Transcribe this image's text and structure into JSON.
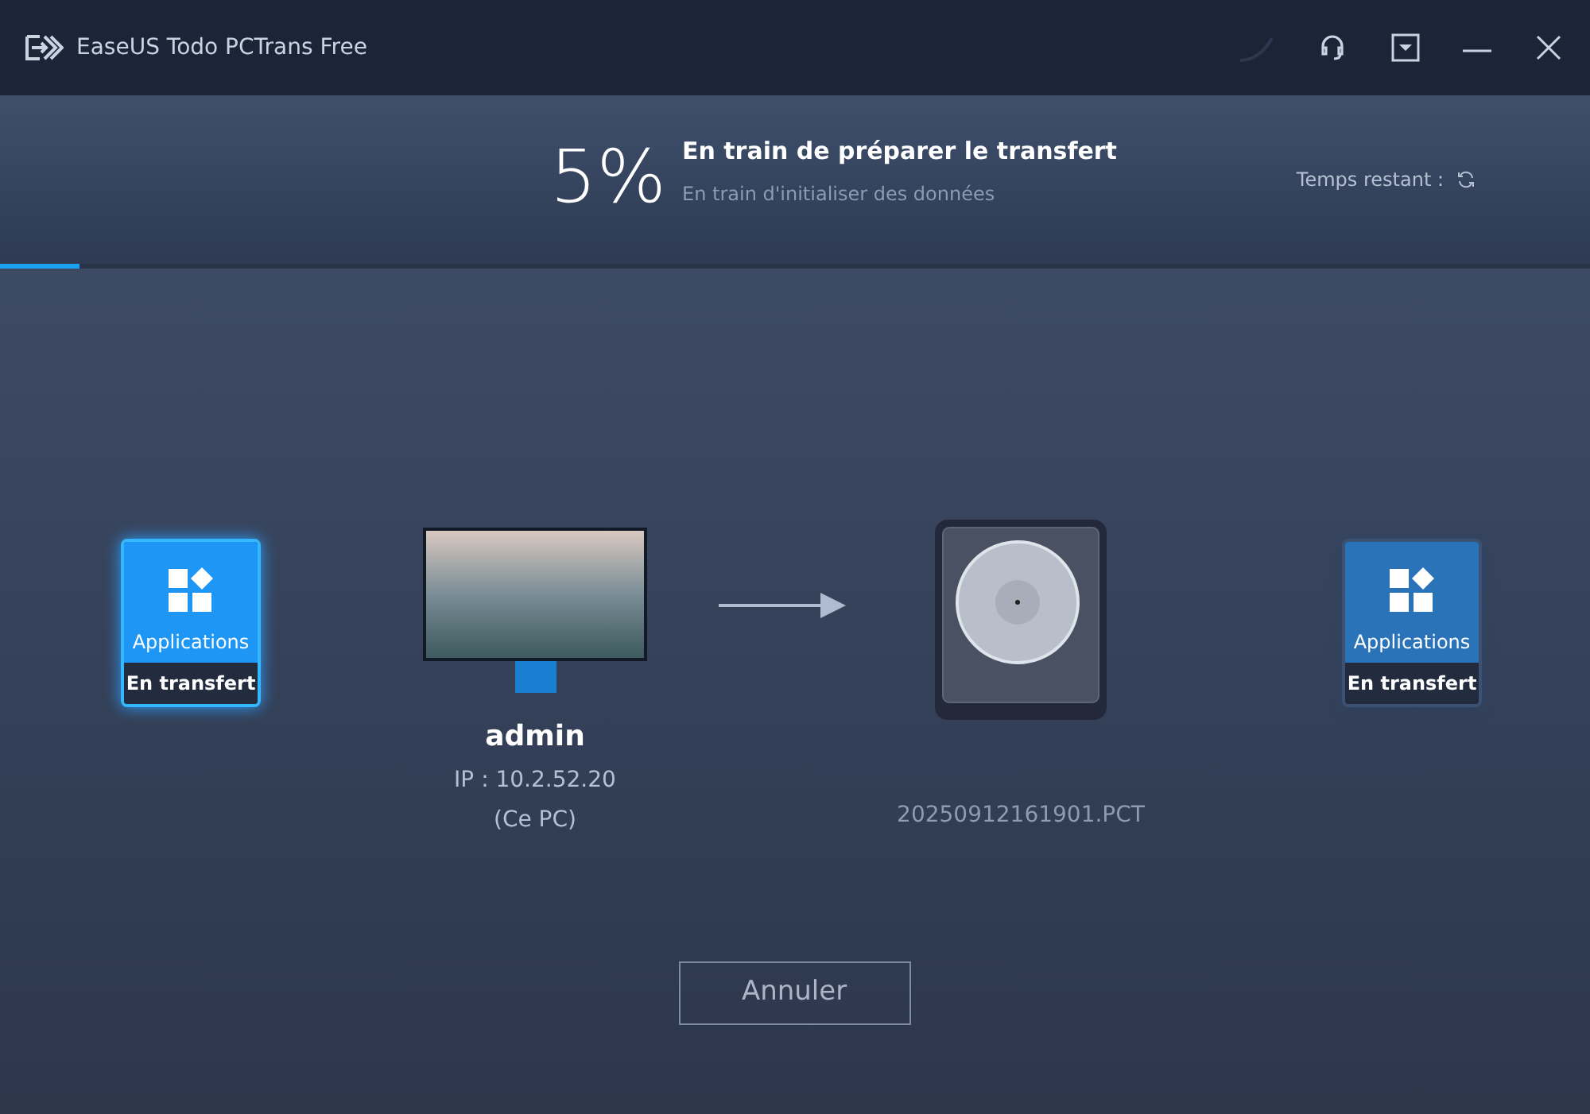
{
  "window": {
    "title": "EaseUS Todo PCTrans Free"
  },
  "progress": {
    "percent": "5%",
    "title": "En train de préparer le transfert",
    "subtitle": "En train d'initialiser des données",
    "remaining_label": "Temps restant :",
    "level": 0.05
  },
  "source_card": {
    "label": "Applications",
    "status": "En transfert",
    "highlighted": true
  },
  "source_pc": {
    "name": "admin",
    "ip": "IP : 10.2.52.20",
    "note": "(Ce PC)"
  },
  "target_file": {
    "name": "20250912161901.PCT"
  },
  "target_card": {
    "label": "Applications",
    "status": "En transfert",
    "highlighted": false
  },
  "buttons": {
    "cancel": "Annuler"
  }
}
